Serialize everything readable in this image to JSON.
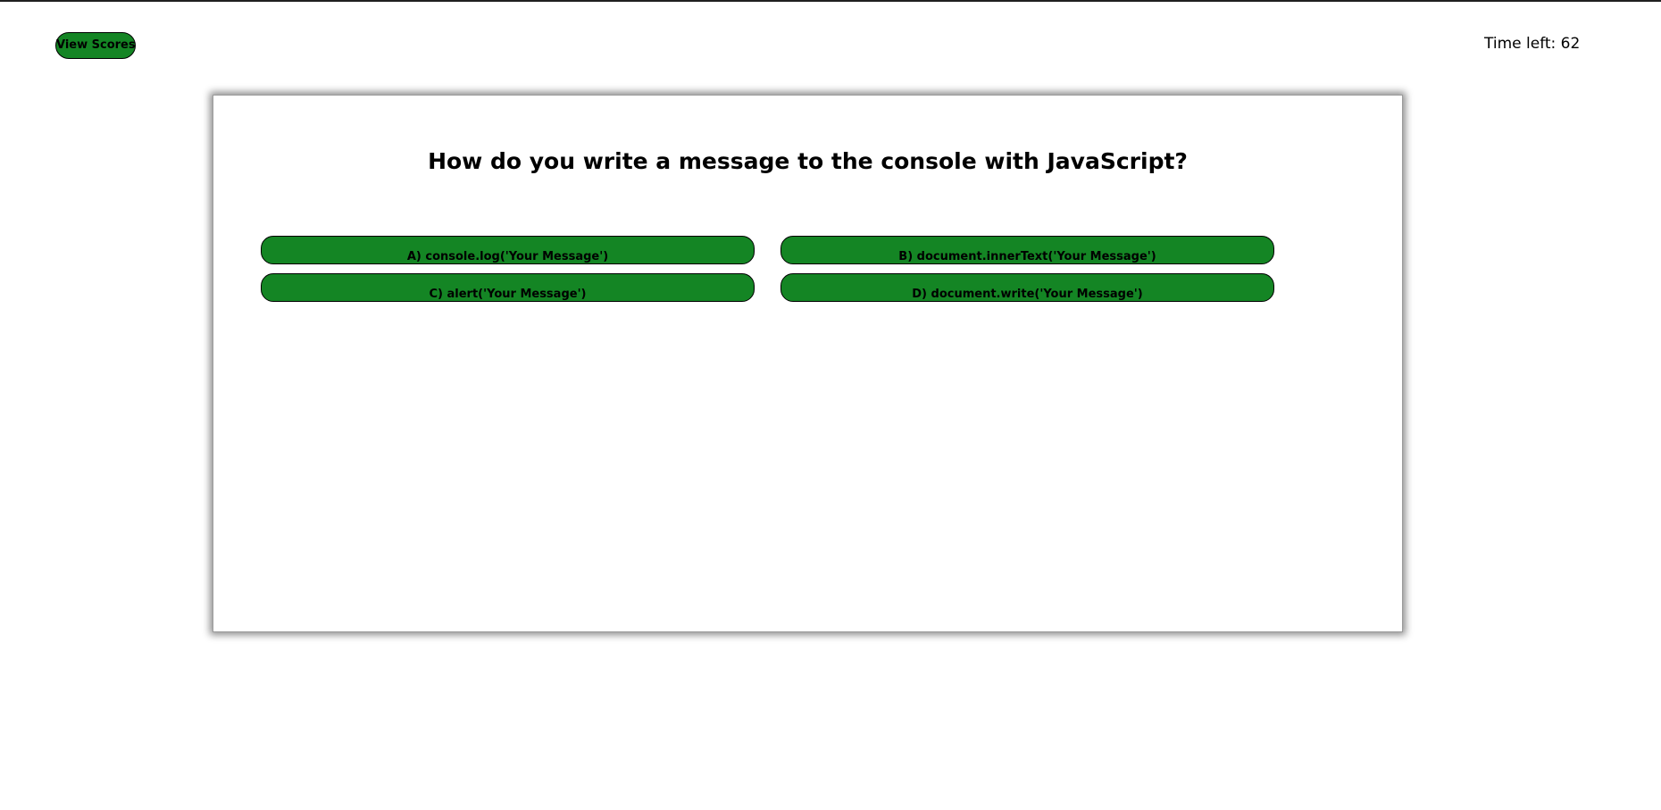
{
  "header": {
    "view_scores_label": "View Scores",
    "timer_text": "Time left: 62"
  },
  "quiz": {
    "question": "How do you write a message to the console with JavaScript?",
    "answers": [
      {
        "label": "A) console.log('Your Message')"
      },
      {
        "label": "B) document.innerText('Your Message')"
      },
      {
        "label": "C) alert('Your Message')"
      },
      {
        "label": "D) document.write('Your Message')"
      }
    ]
  },
  "colors": {
    "button_green": "#148524",
    "top_rule": "#1f1f1f"
  }
}
